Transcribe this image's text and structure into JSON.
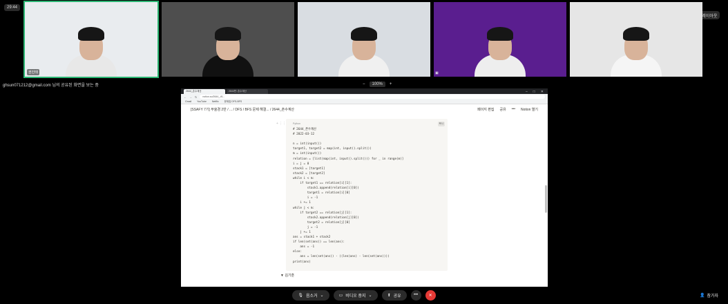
{
  "time": "29:44",
  "layout_button": {
    "label": "레이아웃"
  },
  "tiles": [
    {
      "name": "권인태",
      "bg": "#e9ecef",
      "body": "#e8e8e8",
      "active": true
    },
    {
      "name": "",
      "bg": "#4e4e4e",
      "body": "#111111",
      "active": false
    },
    {
      "name": "",
      "bg": "#d9dde2",
      "body": "#f0f0f0",
      "active": false
    },
    {
      "name": "",
      "bg": "#5a1e8f",
      "body": "#eeeeee",
      "active": false
    },
    {
      "name": "",
      "bg": "#e6e6e6",
      "body": "#f5f5f5",
      "active": false
    }
  ],
  "status_text": "ghsun071212@gmail.com 님의 공유된 화면을 보는 중",
  "zoom": {
    "minus": "−",
    "value": "100%",
    "plus": "+"
  },
  "browser": {
    "tabs": [
      "2644_촌수계산",
      "2644번: 촌수계산"
    ],
    "address": "notion.so/2644_-f6..."
  },
  "bookmarks": [
    "Gmail",
    "YouTube",
    "Netflix",
    "문제집 DFS-BFS"
  ],
  "notion": {
    "breadcrumb": "[SSAFY 7기] 부울경 2반  /  ...  /  DFS / BFS 문제 해결...  /  2644_촌수계산",
    "actions": [
      "페이지 편집",
      "공유",
      "•••",
      "Notion 열기"
    ]
  },
  "code": {
    "language": "Python",
    "copy_label": "복사",
    "text": "# 2644_촌수계산\n# 2022-03-12\n\nn = int(input())\ntarget1, target2 = map(int, input().split())\nm = int(input())\nrelation = [list(map(int, input().split())) for _ in range(m)]\ni = j = 0\nstack1 = [target1]\nstack2 = [target2]\nwhile i < m:\n    if target1 == relation[i][1]:\n        stack1.append(relation[i][0])\n        target1 = relation[i][0]\n        i = -1\n    i += 1\nwhile j < m:\n    if target2 == relation[j][1]:\n        stack2.append(relation[j][0])\n        target2 = relation[j][0]\n        j = -1\n    j += 1\nans = stack1 + stack2\nif len(set(ans)) == len(ans):\n    ans = -1\nelse:\n    ans = len(set(ans)) - ((len(ans) - len(set(ans))))\nprint(ans)"
  },
  "toggle_label": "김기훈",
  "controls": {
    "mute": "음소거",
    "video": "비디오 중지",
    "share": "공유",
    "more": "•••",
    "end": "✕"
  },
  "participants_label": "참가자"
}
